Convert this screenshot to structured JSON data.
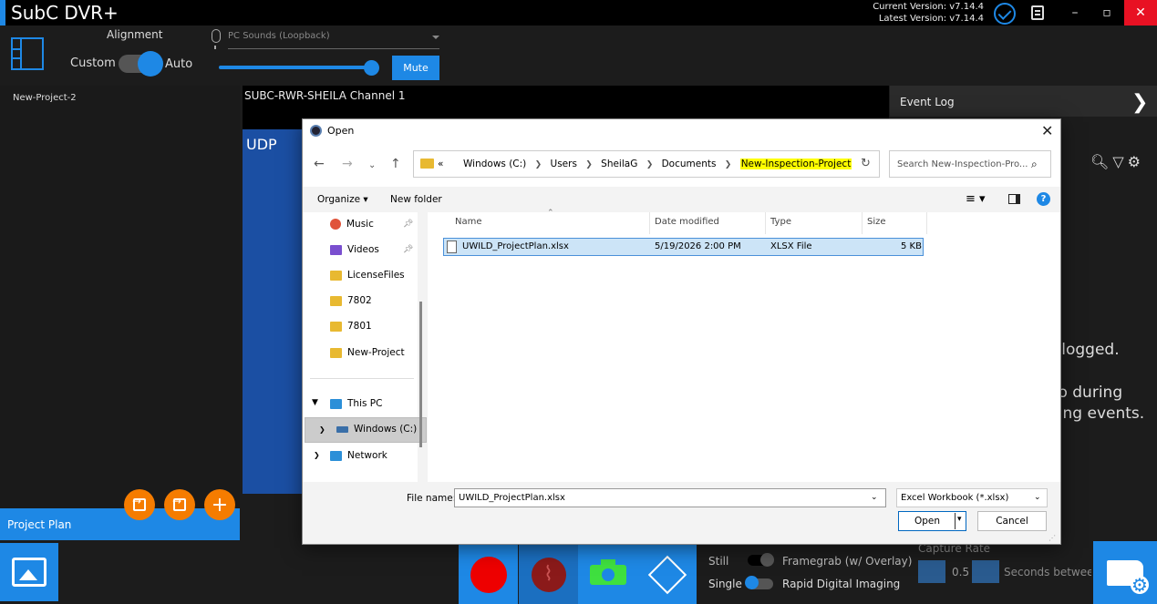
{
  "app": {
    "title": "SubC DVR+",
    "current_version": "Current Version: v7.14.4",
    "latest_version": "Latest Version: v7.14.4"
  },
  "window_controls": {
    "minimize": "–",
    "maximize": "▫",
    "close": "✕"
  },
  "toolbar": {
    "alignment_label": "Alignment",
    "custom_label": "Custom",
    "auto_label": "Auto",
    "auto_enabled": true,
    "audio_source_placeholder": "PC Sounds (Loopback)",
    "volume_level": 1.0,
    "mute_label": "Mute"
  },
  "sidebar": {
    "project_item": "New-Project-2",
    "project_plan_label": "Project Plan",
    "add_symbol": "+"
  },
  "video": {
    "channel_label": "SUBC-RWR-SHEILA Channel 1",
    "stream_label": "UDP"
  },
  "event_log": {
    "title": "Event Log",
    "chevron": "❯",
    "tools": "🔍︎▽⚙",
    "message_line_1": "s logged.",
    "message_line_2": "eo during",
    "message_line_3": "ging events."
  },
  "capture": {
    "still_label": "Still",
    "framegrab_label": "Framegrab (w/ Overlay)",
    "single_label": "Single",
    "rapid_label": "Rapid Digital Imaging",
    "capture_rate_label": "Capture Rate",
    "rate_value": "0.5",
    "rate_unit": "Seconds between s"
  },
  "dialog": {
    "title": "Open",
    "close_glyph": "✕",
    "nav": {
      "back": "←",
      "forward": "→",
      "recent": "⌄",
      "up": "↑",
      "refresh": "↻"
    },
    "path_prefix": "«",
    "path": [
      "Windows (C:)",
      "Users",
      "SheilaG",
      "Documents"
    ],
    "path_current": "New-Inspection-Project",
    "search_placeholder": "Search New-Inspection-Pro...",
    "organize_label": "Organize ▾",
    "new_folder_label": "New folder",
    "view_glyph": "≡ ▾",
    "help_glyph": "?",
    "nav_items": [
      {
        "label": "Music",
        "icon": "music-icon",
        "pinned": true
      },
      {
        "label": "Videos",
        "icon": "video-icon",
        "pinned": true
      },
      {
        "label": "LicenseFiles",
        "icon": "folder-icon"
      },
      {
        "label": "7802",
        "icon": "folder-icon"
      },
      {
        "label": "7801",
        "icon": "folder-icon"
      },
      {
        "label": "New-Project",
        "icon": "folder-icon"
      }
    ],
    "this_pc_label": "This PC",
    "windows_drive_label": "Windows (C:)",
    "network_label": "Network",
    "columns": [
      "Name",
      "Date modified",
      "Type",
      "Size"
    ],
    "files": [
      {
        "name": "UWILD_ProjectPlan.xlsx",
        "date": "5/19/2026 2:00 PM",
        "type": "XLSX File",
        "size": "5 KB"
      }
    ],
    "filename_label": "File name:",
    "filename_value": "UWILD_ProjectPlan.xlsx",
    "filetype_value": "Excel Workbook (*.xlsx)",
    "open_label": "Open",
    "cancel_label": "Cancel"
  },
  "colors": {
    "accent": "#1e88e5",
    "fab": "#f57c00",
    "record": "#ee0000",
    "snapshot": "#3fe03f",
    "highlight": "#ffff00"
  }
}
